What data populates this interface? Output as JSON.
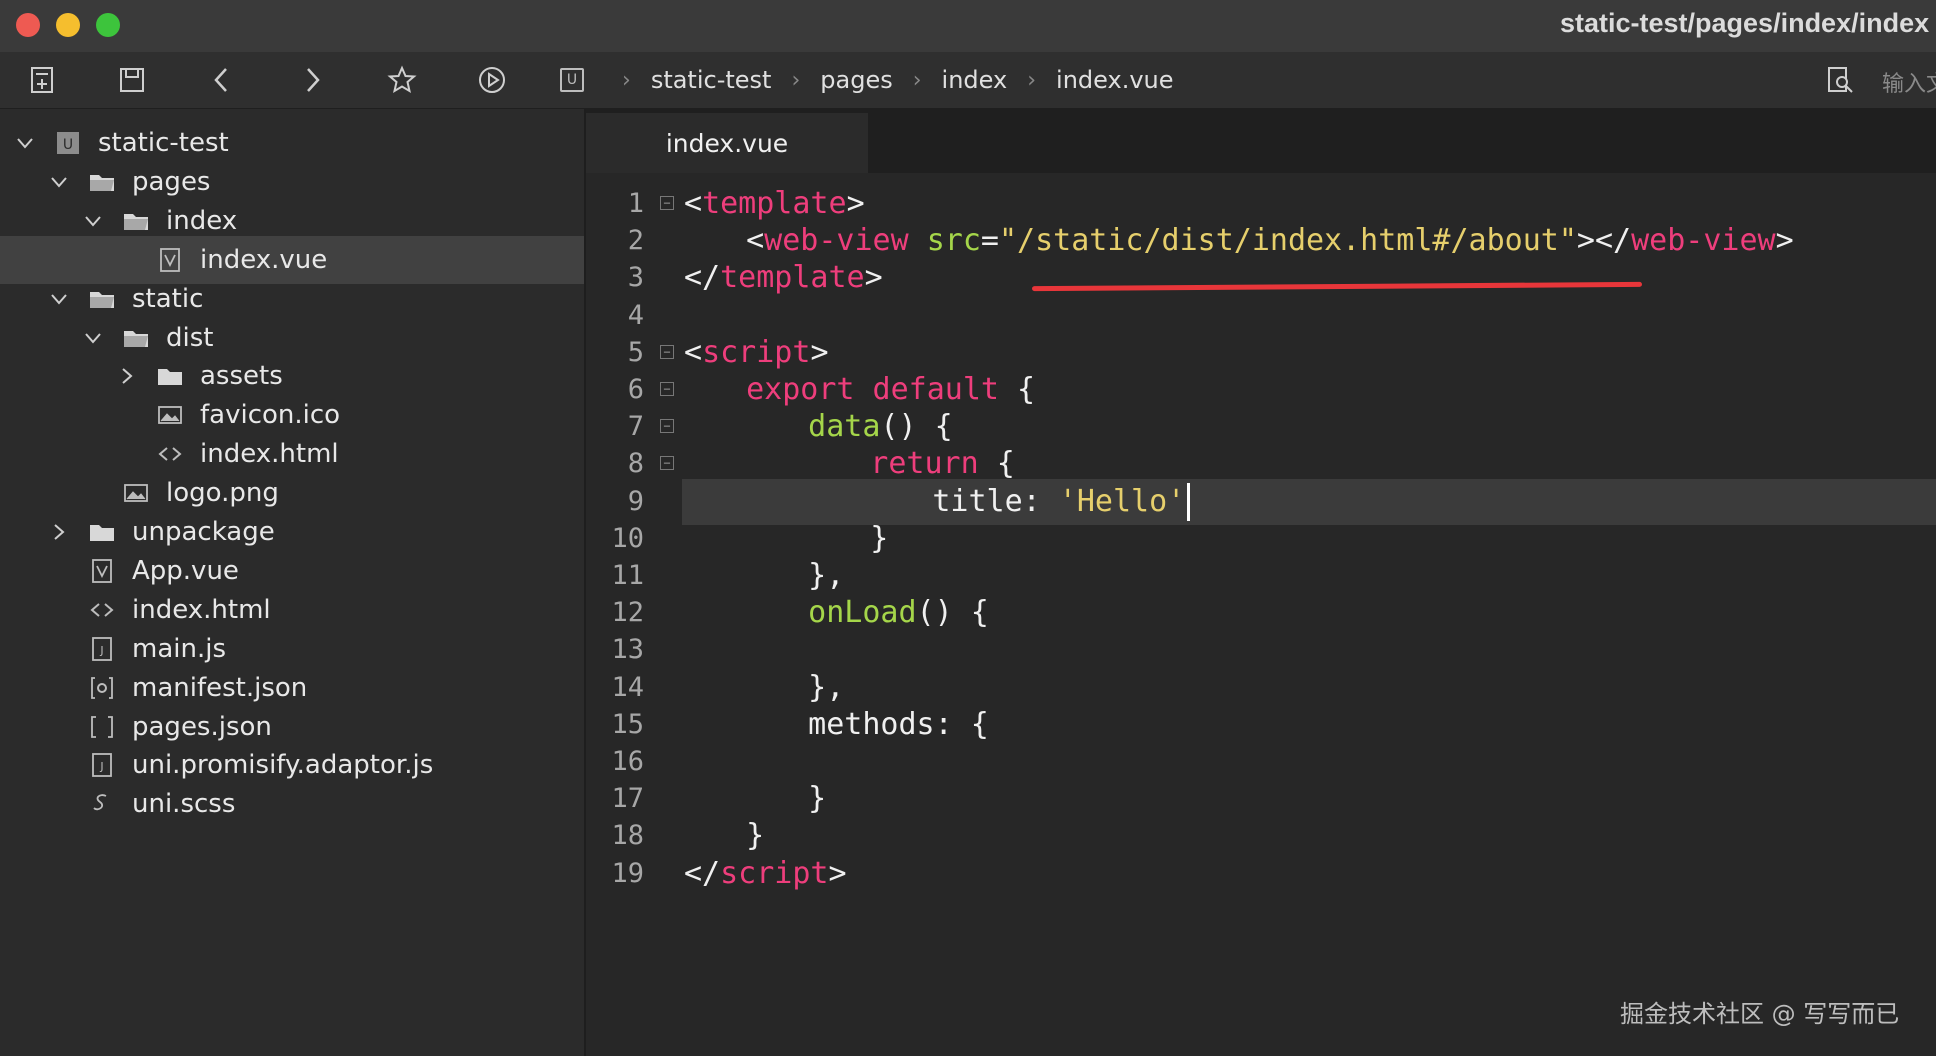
{
  "window": {
    "title": "static-test/pages/index/index"
  },
  "toolbar": {
    "breadcrumb": [
      "static-test",
      "pages",
      "index",
      "index.vue"
    ],
    "input_hint": "输入文"
  },
  "sidebar": {
    "items": [
      {
        "label": "static-test",
        "icon": "project-icon",
        "depth": 0,
        "chevron": "down"
      },
      {
        "label": "pages",
        "icon": "folder-open-icon",
        "depth": 1,
        "chevron": "down"
      },
      {
        "label": "index",
        "icon": "folder-open-icon",
        "depth": 2,
        "chevron": "down"
      },
      {
        "label": "index.vue",
        "icon": "vue-file-icon",
        "depth": 3,
        "chevron": "",
        "selected": true
      },
      {
        "label": "static",
        "icon": "folder-open-icon",
        "depth": 1,
        "chevron": "down"
      },
      {
        "label": "dist",
        "icon": "folder-open-icon",
        "depth": 2,
        "chevron": "down"
      },
      {
        "label": "assets",
        "icon": "folder-icon",
        "depth": 3,
        "chevron": "right"
      },
      {
        "label": "favicon.ico",
        "icon": "image-file-icon",
        "depth": 3,
        "chevron": ""
      },
      {
        "label": "index.html",
        "icon": "html-file-icon",
        "depth": 3,
        "chevron": ""
      },
      {
        "label": "logo.png",
        "icon": "image-file-icon",
        "depth": 2,
        "chevron": ""
      },
      {
        "label": "unpackage",
        "icon": "folder-icon",
        "depth": 1,
        "chevron": "right"
      },
      {
        "label": "App.vue",
        "icon": "vue-file-icon",
        "depth": 1,
        "chevron": ""
      },
      {
        "label": "index.html",
        "icon": "html-file-icon",
        "depth": 1,
        "chevron": ""
      },
      {
        "label": "main.js",
        "icon": "js-file-icon",
        "depth": 1,
        "chevron": ""
      },
      {
        "label": "manifest.json",
        "icon": "manifest-file-icon",
        "depth": 1,
        "chevron": ""
      },
      {
        "label": "pages.json",
        "icon": "json-file-icon",
        "depth": 1,
        "chevron": ""
      },
      {
        "label": "uni.promisify.adaptor.js",
        "icon": "js-file-icon",
        "depth": 1,
        "chevron": ""
      },
      {
        "label": "uni.scss",
        "icon": "scss-file-icon",
        "depth": 1,
        "chevron": ""
      }
    ]
  },
  "editor": {
    "tab_label": "index.vue",
    "current_line": 9,
    "lines": [
      {
        "n": "1",
        "fold": true,
        "indent": 0,
        "tokens": [
          [
            "plain",
            "<"
          ],
          [
            "tag",
            "template"
          ],
          [
            "plain",
            ">"
          ]
        ]
      },
      {
        "n": "2",
        "fold": false,
        "indent": 2,
        "tokens": [
          [
            "plain",
            "<"
          ],
          [
            "tag",
            "web-view"
          ],
          [
            "plain",
            " "
          ],
          [
            "attr",
            "src"
          ],
          [
            "plain",
            "="
          ],
          [
            "str",
            "\"/static/dist/index.html#/about\""
          ],
          [
            "plain",
            "></"
          ],
          [
            "tag",
            "web-view"
          ],
          [
            "plain",
            ">"
          ]
        ]
      },
      {
        "n": "3",
        "fold": false,
        "indent": 0,
        "tokens": [
          [
            "plain",
            "</"
          ],
          [
            "tag",
            "template"
          ],
          [
            "plain",
            ">"
          ]
        ]
      },
      {
        "n": "4",
        "fold": false,
        "indent": 0,
        "tokens": []
      },
      {
        "n": "5",
        "fold": true,
        "indent": 0,
        "tokens": [
          [
            "plain",
            "<"
          ],
          [
            "tag",
            "script"
          ],
          [
            "plain",
            ">"
          ]
        ]
      },
      {
        "n": "6",
        "fold": true,
        "indent": 2,
        "tokens": [
          [
            "kw",
            "export default"
          ],
          [
            "plain",
            " {"
          ]
        ]
      },
      {
        "n": "7",
        "fold": true,
        "indent": 4,
        "tokens": [
          [
            "fn",
            "data"
          ],
          [
            "plain",
            "() {"
          ]
        ]
      },
      {
        "n": "8",
        "fold": true,
        "indent": 6,
        "tokens": [
          [
            "kw",
            "return"
          ],
          [
            "plain",
            " {"
          ]
        ]
      },
      {
        "n": "9",
        "fold": false,
        "indent": 8,
        "tokens": [
          [
            "plain",
            "title: "
          ],
          [
            "str",
            "'Hello'"
          ]
        ],
        "cursor": true
      },
      {
        "n": "10",
        "fold": false,
        "indent": 6,
        "tokens": [
          [
            "plain",
            "}"
          ]
        ]
      },
      {
        "n": "11",
        "fold": false,
        "indent": 4,
        "tokens": [
          [
            "plain",
            "},"
          ]
        ]
      },
      {
        "n": "12",
        "fold": false,
        "indent": 4,
        "tokens": [
          [
            "fn",
            "onLoad"
          ],
          [
            "plain",
            "() {"
          ]
        ]
      },
      {
        "n": "13",
        "fold": false,
        "indent": 0,
        "tokens": []
      },
      {
        "n": "14",
        "fold": false,
        "indent": 4,
        "tokens": [
          [
            "plain",
            "},"
          ]
        ]
      },
      {
        "n": "15",
        "fold": false,
        "indent": 4,
        "tokens": [
          [
            "plain",
            "methods: {"
          ]
        ]
      },
      {
        "n": "16",
        "fold": false,
        "indent": 0,
        "tokens": []
      },
      {
        "n": "17",
        "fold": false,
        "indent": 4,
        "tokens": [
          [
            "plain",
            "}"
          ]
        ]
      },
      {
        "n": "18",
        "fold": false,
        "indent": 2,
        "tokens": [
          [
            "plain",
            "}"
          ]
        ]
      },
      {
        "n": "19",
        "fold": false,
        "indent": 0,
        "tokens": [
          [
            "plain",
            "</"
          ],
          [
            "tag",
            "script"
          ],
          [
            "plain",
            ">"
          ]
        ]
      }
    ]
  },
  "annotation": {
    "underline_color": "#e8363a"
  },
  "watermark": "掘金技术社区 @ 写写而已",
  "colors": {
    "tag": "#ee3e7c",
    "attr": "#a5d64a",
    "string": "#e6cf6c",
    "keyword": "#ee3e7c",
    "function": "#a5d64a"
  }
}
